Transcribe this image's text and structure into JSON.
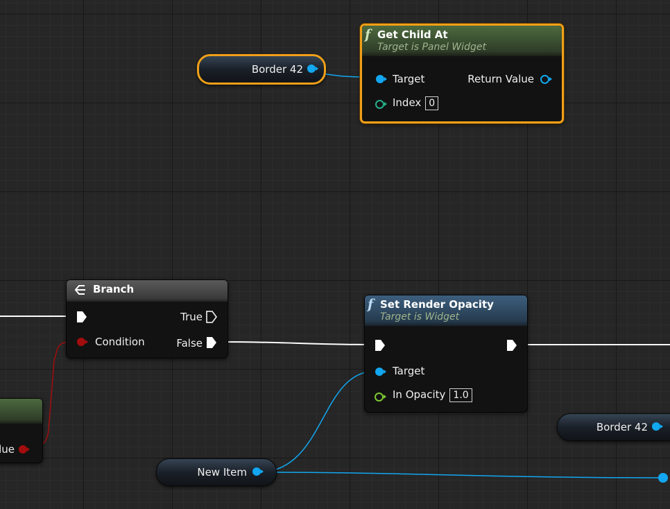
{
  "nodes": {
    "get_child_at": {
      "title": "Get Child At",
      "subtitle": "Target is Panel Widget",
      "target_label": "Target",
      "return_label": "Return Value",
      "index_label": "Index",
      "index_value": "0"
    },
    "branch": {
      "title": "Branch",
      "true_label": "True",
      "condition_label": "Condition",
      "false_label": "False"
    },
    "set_render_opacity": {
      "title": "Set Render Opacity",
      "subtitle": "Target is Widget",
      "target_label": "Target",
      "opacity_label": "In Opacity",
      "opacity_value": "1.0"
    },
    "partial_node": {
      "value_label": "lue"
    }
  },
  "variables": {
    "border_top": "Border 42",
    "border_right": "Border 42",
    "new_item": "New Item"
  },
  "icons": {
    "function": "f",
    "branch": "branch-icon"
  },
  "colors": {
    "selection": "#f0a018",
    "object_pin": "#12a7f0",
    "bool_pin": "#a30d0d",
    "exec_wire": "#ffffff",
    "pure_header": "#4d6a3e",
    "impure_header": "#3d5f7e",
    "branch_header": "#4a4a4a"
  }
}
